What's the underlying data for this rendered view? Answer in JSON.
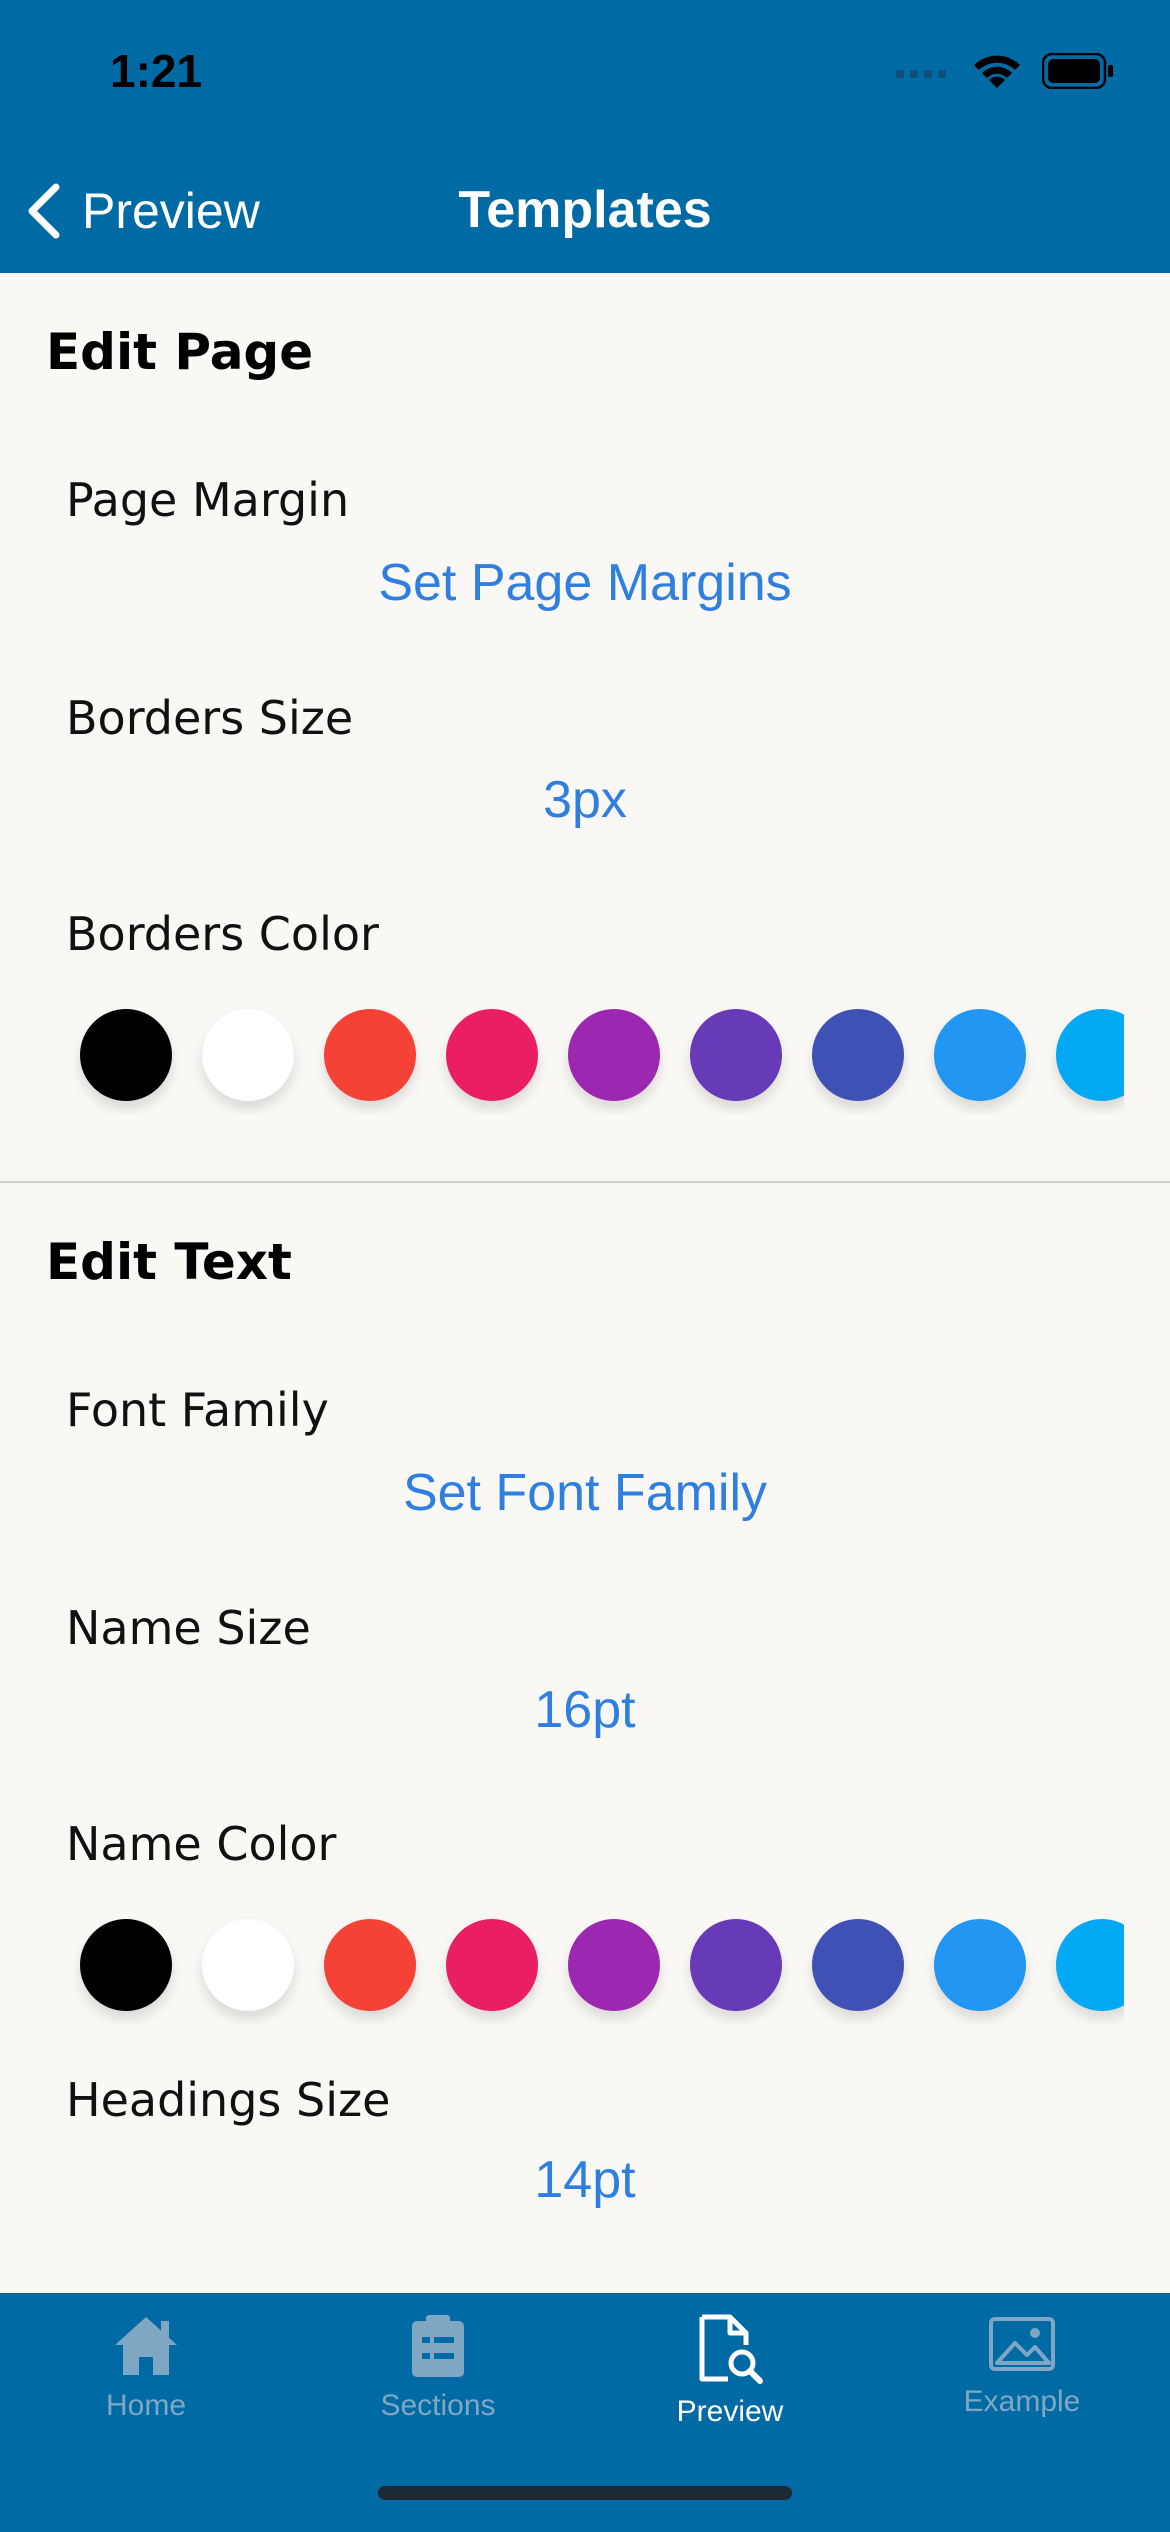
{
  "status": {
    "time": "1:21"
  },
  "nav": {
    "back_label": "Preview",
    "title": "Templates"
  },
  "sections": {
    "page": {
      "title": "Edit Page",
      "margin": {
        "label": "Page Margin",
        "value": "Set Page Margins"
      },
      "border_size": {
        "label": "Borders Size",
        "value": "3px"
      },
      "border_color": {
        "label": "Borders Color"
      }
    },
    "text": {
      "title": "Edit Text",
      "font_family": {
        "label": "Font Family",
        "value": "Set Font Family"
      },
      "name_size": {
        "label": "Name Size",
        "value": "16pt"
      },
      "name_color": {
        "label": "Name Color"
      },
      "headings_size": {
        "label": "Headings Size",
        "value": "14pt"
      }
    }
  },
  "palette": [
    "#000000",
    "#ffffff",
    "#f44336",
    "#e91e63",
    "#9c27b0",
    "#673ab7",
    "#3f51b5",
    "#2196f3",
    "#03a9f4"
  ],
  "colors": {
    "bar": "#006aa4",
    "accent": "#2f7fe0",
    "tab_active": "#ffffff",
    "tab_inactive": "#7fa7c3"
  },
  "tabs": [
    {
      "label": "Home",
      "icon": "home-icon",
      "active": false
    },
    {
      "label": "Sections",
      "icon": "clipboard-list-icon",
      "active": false
    },
    {
      "label": "Preview",
      "icon": "document-search-icon",
      "active": true
    },
    {
      "label": "Example",
      "icon": "image-icon",
      "active": false
    }
  ]
}
